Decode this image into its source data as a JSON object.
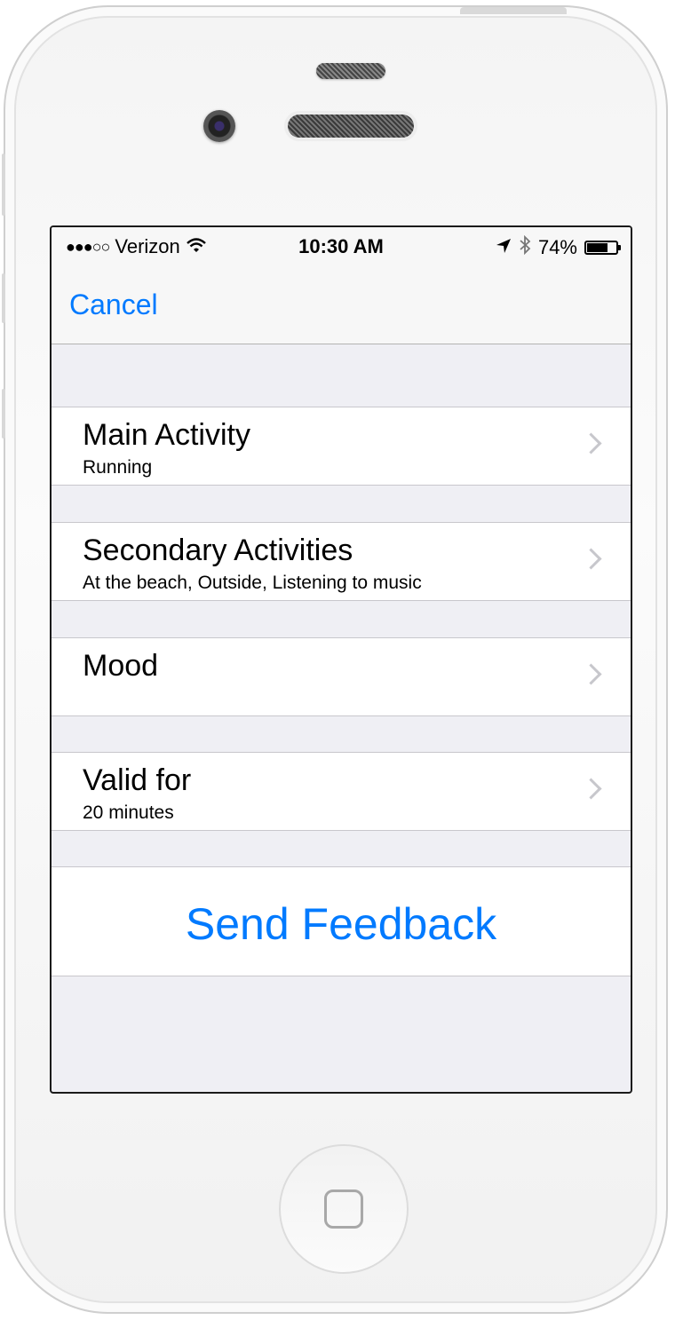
{
  "status_bar": {
    "signal": "●●●○○",
    "carrier": "Verizon",
    "time": "10:30 AM",
    "battery_percent": "74%",
    "battery_level": 0.74
  },
  "nav": {
    "cancel_label": "Cancel"
  },
  "cells": [
    {
      "title": "Main Activity",
      "subtitle": "Running"
    },
    {
      "title": "Secondary Activities",
      "subtitle": "At the beach, Outside, Listening to music"
    },
    {
      "title": "Mood",
      "subtitle": ""
    },
    {
      "title": "Valid for",
      "subtitle": "20 minutes"
    }
  ],
  "send_button": {
    "label": "Send Feedback"
  },
  "colors": {
    "accent": "#007aff",
    "background": "#efeff4",
    "separator": "#c8c7cc",
    "chevron": "#c7c7cc"
  },
  "icons": {
    "wifi": "wifi-icon",
    "location": "location-arrow-icon",
    "bluetooth": "bluetooth-icon",
    "battery": "battery-icon",
    "chevron": "chevron-right-icon"
  }
}
